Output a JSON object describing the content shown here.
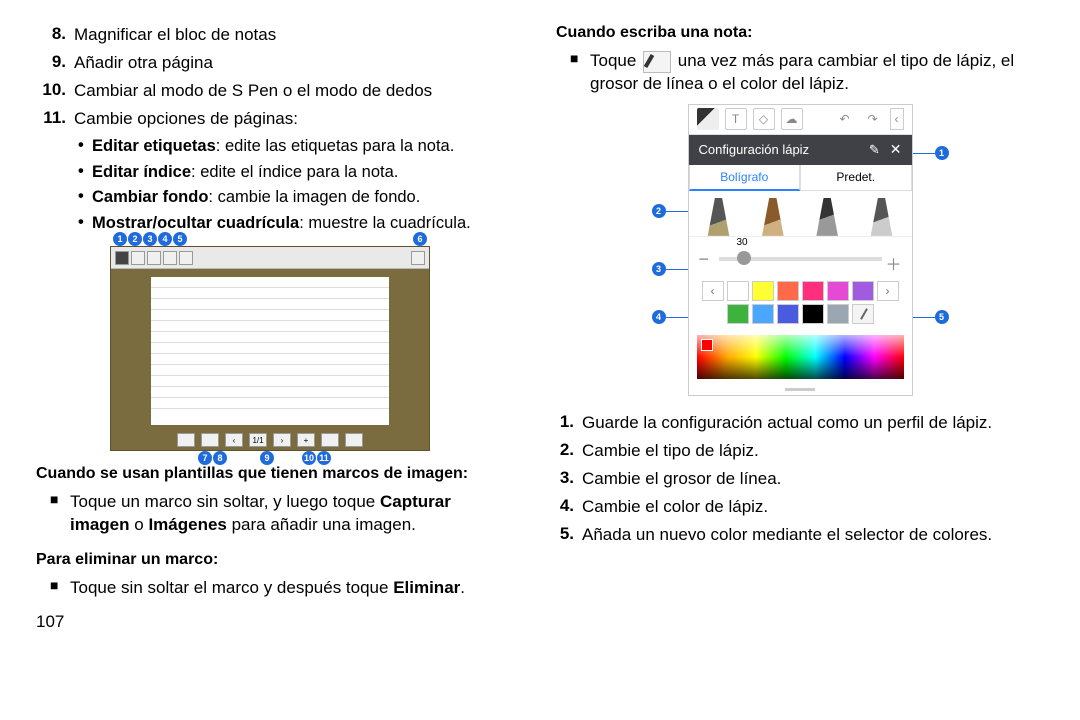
{
  "left": {
    "list": [
      {
        "n": "8.",
        "t": "Magnificar el bloc de notas"
      },
      {
        "n": "9.",
        "t": "Añadir otra página"
      },
      {
        "n": "10.",
        "t": "Cambiar al modo de S Pen o el modo de dedos"
      },
      {
        "n": "11.",
        "t": "Cambie opciones de páginas:"
      }
    ],
    "bullets": [
      {
        "b": "Editar etiquetas",
        "rest": ": edite las etiquetas para la nota."
      },
      {
        "b": "Editar índice",
        "rest": ": edite el índice para la nota."
      },
      {
        "b": "Cambiar fondo",
        "rest": ": cambie la imagen de fondo."
      },
      {
        "b": "Mostrar/ocultar cuadrícula",
        "rest": ": muestre la cuadrícula."
      }
    ],
    "h_template": "Cuando se usan plantillas que tienen marcos de imagen:",
    "sq_template_a": "Toque un marco sin soltar, y luego toque ",
    "sq_template_b": "Capturar imagen",
    "sq_template_c": " o ",
    "sq_template_d": "Imágenes",
    "sq_template_e": " para añadir una imagen.",
    "h_del": "Para eliminar un marco:",
    "sq_del_a": "Toque sin soltar el marco y después toque ",
    "sq_del_b": "Eliminar",
    "sq_del_c": ".",
    "page_ind": "1/1",
    "page_num": "107",
    "callouts_top": [
      "1",
      "2",
      "3",
      "4",
      "5",
      "6"
    ],
    "callouts_bot": [
      "7",
      "8",
      "9",
      "10",
      "11"
    ]
  },
  "right": {
    "h_write": "Cuando escriba una nota:",
    "sq_w_a": "Toque ",
    "sq_w_b": " una vez más para cambiar el tipo de lápiz, el grosor de línea o el color del lápiz.",
    "pen_head": "Configuración lápiz",
    "tab_active": "Bolígrafo",
    "tab_preset": "Predet.",
    "slider_val": "30",
    "top_icons": {
      "t": "T"
    },
    "colors_row1": [
      "#ffffff",
      "#ffff33",
      "#ff6a4a",
      "#ff2f7d",
      "#e44ad6",
      "#a05be0"
    ],
    "colors_row2": [
      "#3db23d",
      "#4aa7ff",
      "#4a5be0",
      "#000000",
      "#9aa7b0"
    ],
    "callouts": [
      "1",
      "2",
      "3",
      "4",
      "5"
    ],
    "list": [
      {
        "n": "1.",
        "t": "Guarde la configuración actual como un perfil de lápiz."
      },
      {
        "n": "2.",
        "t": "Cambie el tipo de lápiz."
      },
      {
        "n": "3.",
        "t": "Cambie el grosor de línea."
      },
      {
        "n": "4.",
        "t": "Cambie el color de lápiz."
      },
      {
        "n": "5.",
        "t": "Añada un nuevo color mediante el selector de colores."
      }
    ]
  }
}
